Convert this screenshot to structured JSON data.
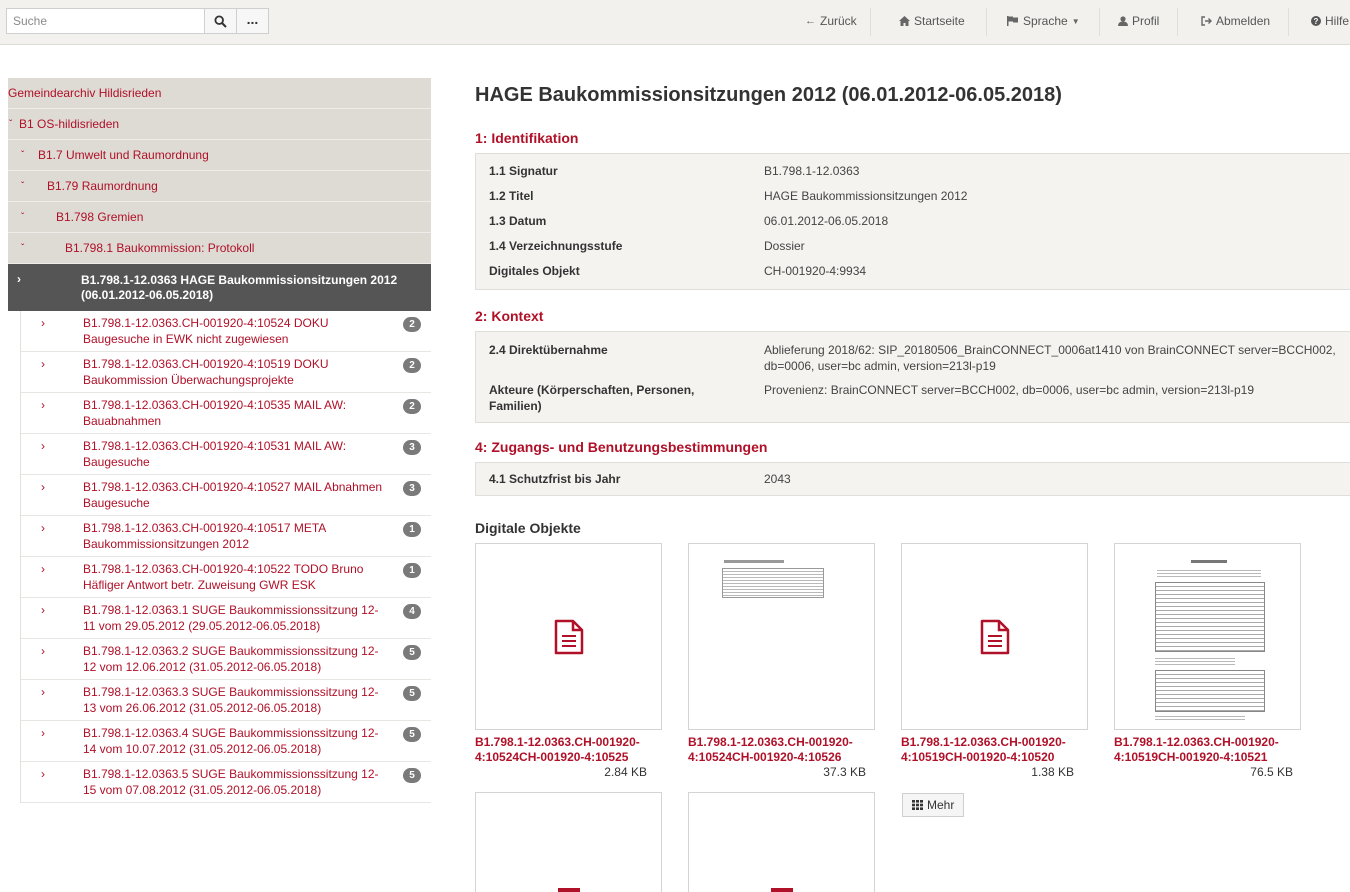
{
  "topbar": {
    "search_placeholder": "Suche",
    "nav": {
      "back": "Zurück",
      "home": "Startseite",
      "language": "Sprache",
      "profile": "Profil",
      "logout": "Abmelden",
      "help": "Hilfe"
    }
  },
  "tree": {
    "archive": "Gemeindearchiv Hildisrieden",
    "levels": [
      "B1 OS-hildisrieden",
      "B1.7 Umwelt und Raumordnung",
      "B1.79 Raumordnung",
      "B1.798 Gremien",
      "B1.798.1 Baukommission: Protokoll"
    ],
    "active": "B1.798.1-12.0363 HAGE Baukommissionsitzungen 2012 (06.01.2012-06.05.2018)",
    "children": [
      {
        "text": "B1.798.1-12.0363.CH-001920-4:10524 DOKU Baugesuche in EWK nicht zugewiesen",
        "count": "2"
      },
      {
        "text": "B1.798.1-12.0363.CH-001920-4:10519 DOKU Baukommission Überwachungsprojekte",
        "count": "2"
      },
      {
        "text": "B1.798.1-12.0363.CH-001920-4:10535 MAIL AW: Bauabnahmen",
        "count": "2"
      },
      {
        "text": "B1.798.1-12.0363.CH-001920-4:10531 MAIL AW: Baugesuche",
        "count": "3"
      },
      {
        "text": "B1.798.1-12.0363.CH-001920-4:10527 MAIL Abnahmen Baugesuche",
        "count": "3"
      },
      {
        "text": "B1.798.1-12.0363.CH-001920-4:10517 META Baukommissionsitzungen 2012",
        "count": "1"
      },
      {
        "text": "B1.798.1-12.0363.CH-001920-4:10522 TODO Bruno Häfliger Antwort betr. Zuweisung GWR ESK",
        "count": "1"
      },
      {
        "text": "B1.798.1-12.0363.1 SUGE Baukommissionssitzung 12-11 vom 29.05.2012 (29.05.2012-06.05.2018)",
        "count": "4"
      },
      {
        "text": "B1.798.1-12.0363.2 SUGE Baukommissionssitzung 12-12 vom 12.06.2012 (31.05.2012-06.05.2018)",
        "count": "5"
      },
      {
        "text": "B1.798.1-12.0363.3 SUGE Baukommissionssitzung 12-13 vom 26.06.2012 (31.05.2012-06.05.2018)",
        "count": "5"
      },
      {
        "text": "B1.798.1-12.0363.4 SUGE Baukommissionssitzung 12-14 vom 10.07.2012 (31.05.2012-06.05.2018)",
        "count": "5"
      },
      {
        "text": "B1.798.1-12.0363.5 SUGE Baukommissionssitzung 12-15 vom 07.08.2012 (31.05.2012-06.05.2018)",
        "count": "5"
      }
    ]
  },
  "main": {
    "title": "HAGE Baukommissionsitzungen 2012 (06.01.2012-06.05.2018)",
    "sections": [
      {
        "title": "1: Identifikation",
        "rows": [
          {
            "label": "1.1 Signatur",
            "value": "B1.798.1-12.0363"
          },
          {
            "label": "1.2 Titel",
            "value": "HAGE Baukommissionsitzungen 2012"
          },
          {
            "label": "1.3 Datum",
            "value": "06.01.2012-06.05.2018"
          },
          {
            "label": "1.4 Verzeichnungsstufe",
            "value": "Dossier"
          },
          {
            "label": "Digitales Objekt",
            "value": "CH-001920-4:9934"
          }
        ]
      },
      {
        "title": "2: Kontext",
        "rows": [
          {
            "label": "2.4 Direktübernahme",
            "value": "Ablieferung 2018/62: SIP_20180506_BrainCONNECT_0006at1410 von BrainCONNECT server=BCCH002, db=0006, user=bc admin, version=213l-p19"
          },
          {
            "label": "Akteure (Körperschaften, Personen, Familien)",
            "value": "Provenienz: BrainCONNECT server=BCCH002, db=0006, user=bc admin, version=213l-p19"
          }
        ]
      },
      {
        "title": "4: Zugangs- und Benutzungsbestimmungen",
        "rows": [
          {
            "label": "4.1 Schutzfrist bis Jahr",
            "value": "2043"
          }
        ]
      }
    ],
    "digital_objects_title": "Digitale Objekte",
    "objects": [
      {
        "caption": "B1.798.1-12.0363.CH-001920-4:10524CH-001920-4:10525",
        "size": "2.84 KB",
        "thumb": "file-icon"
      },
      {
        "caption": "B1.798.1-12.0363.CH-001920-4:10524CH-001920-4:10526",
        "size": "37.3 KB",
        "thumb": "table-preview"
      },
      {
        "caption": "B1.798.1-12.0363.CH-001920-4:10519CH-001920-4:10520",
        "size": "1.38 KB",
        "thumb": "file-icon"
      },
      {
        "caption": "B1.798.1-12.0363.CH-001920-4:10519CH-001920-4:10521",
        "size": "76.5 KB",
        "thumb": "document-preview"
      }
    ],
    "more_label": "Mehr"
  },
  "colors": {
    "accent": "#b01028",
    "active_bg": "#555555",
    "tree_head_bg": "#dedbd4",
    "topbar_bg": "#f2f1ee"
  }
}
